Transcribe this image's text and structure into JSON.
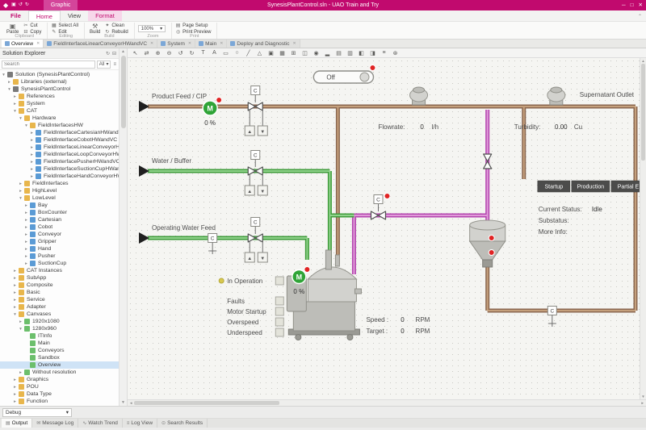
{
  "colors": {
    "accent": "#c10a6e",
    "pipe_brown": "#8a6750",
    "pipe_brown_light": "#c5a07c",
    "pipe_green": "#3f9c3b",
    "pipe_green_light": "#90d28b",
    "pipe_magenta": "#b344ae",
    "pipe_magenta_light": "#e09ad9",
    "motor_green": "#2fa437",
    "alarm_red": "#e02424",
    "button_dark": "#4c4c4b",
    "canvas_bg": "#f5f5f2"
  },
  "titlebar": {
    "context_tab": "Graphic",
    "title": "SynesisPlantControl.sln - UAO Train and Try",
    "quick_access": [
      {
        "name": "save",
        "glyph": "▣"
      },
      {
        "name": "undo",
        "glyph": "↺"
      },
      {
        "name": "redo",
        "glyph": "↻"
      }
    ],
    "window_buttons": [
      {
        "name": "minimize",
        "glyph": "─"
      },
      {
        "name": "maximize",
        "glyph": "□"
      },
      {
        "name": "close",
        "glyph": "✕"
      }
    ]
  },
  "ribbon": {
    "tabs": [
      {
        "label": "File",
        "file": true
      },
      {
        "label": "Home",
        "active": true
      },
      {
        "label": "View"
      },
      {
        "label": "Format",
        "contextual": true
      }
    ],
    "groups": [
      {
        "label": "Clipboard",
        "items": [
          {
            "label": "Paste",
            "glyph": "▣",
            "big": true
          },
          {
            "label": "Cut",
            "glyph": "✂"
          },
          {
            "label": "Copy",
            "glyph": "⊟"
          }
        ]
      },
      {
        "label": "Editing",
        "items": [
          {
            "label": "Select All",
            "glyph": "▦"
          },
          {
            "label": "Edit",
            "glyph": "✎"
          }
        ]
      },
      {
        "label": "Build",
        "items": [
          {
            "label": "Build",
            "glyph": "⚒",
            "big": true
          },
          {
            "label": "Clean",
            "glyph": "✦"
          },
          {
            "label": "Rebuild",
            "glyph": "↻"
          }
        ]
      },
      {
        "label": "Zoom",
        "value": "100%"
      },
      {
        "label": "Print",
        "items": [
          {
            "label": "Page Setup",
            "glyph": "▤"
          },
          {
            "label": "Print Preview",
            "glyph": "◎"
          }
        ]
      }
    ]
  },
  "doc_tabs": [
    {
      "label": "Overview",
      "active": true
    },
    {
      "label": "FieldInterfaceLinearConveyorHWandVC"
    },
    {
      "label": "System"
    },
    {
      "label": "Main"
    },
    {
      "label": "Deploy and Diagnostic"
    }
  ],
  "solution_explorer": {
    "title": "Solution Explorer",
    "search_placeholder": "Search",
    "filter_value": "All",
    "tree": [
      {
        "label": "Solution (SynesisPlantControl)",
        "level": 0,
        "toggle": "open",
        "kind": "sol"
      },
      {
        "label": "Libraries (external)",
        "level": 1,
        "toggle": "closed",
        "kind": "fld"
      },
      {
        "label": "SynesisPlantControl",
        "level": 1,
        "toggle": "open",
        "kind": "sol"
      },
      {
        "label": "References",
        "level": 2,
        "toggle": "closed",
        "kind": "fld"
      },
      {
        "label": "System",
        "level": 2,
        "toggle": "closed",
        "kind": "fld"
      },
      {
        "label": "CAT",
        "level": 2,
        "toggle": "open",
        "kind": "fld"
      },
      {
        "label": "Hardware",
        "level": 3,
        "toggle": "open",
        "kind": "fld"
      },
      {
        "label": "FieldInterfacesHW",
        "level": 4,
        "toggle": "open",
        "kind": "fld"
      },
      {
        "label": "FieldInterfaceCartesianHWandVC",
        "level": 5,
        "toggle": "closed",
        "kind": "pou"
      },
      {
        "label": "FieldInterfaceCobotHWandVC",
        "level": 5,
        "toggle": "closed",
        "kind": "pou"
      },
      {
        "label": "FieldInterfaceLinearConveyorHWandVC",
        "level": 5,
        "toggle": "closed",
        "kind": "pou"
      },
      {
        "label": "FieldInterfaceLoopConveyorHWandVC",
        "level": 5,
        "toggle": "closed",
        "kind": "pou"
      },
      {
        "label": "FieldInterfacePusherHWandVC",
        "level": 5,
        "toggle": "closed",
        "kind": "pou"
      },
      {
        "label": "FieldInterfaceSuctionCupHWandVC",
        "level": 5,
        "toggle": "closed",
        "kind": "pou"
      },
      {
        "label": "FieldInterfaceHandConveyorHWandVC",
        "level": 5,
        "toggle": "closed",
        "kind": "pou"
      },
      {
        "label": "FieldInterfaces",
        "level": 3,
        "toggle": "closed",
        "kind": "fld"
      },
      {
        "label": "HighLevel",
        "level": 3,
        "toggle": "closed",
        "kind": "fld"
      },
      {
        "label": "LowLevel",
        "level": 3,
        "toggle": "open",
        "kind": "fld"
      },
      {
        "label": "Bay",
        "level": 4,
        "toggle": "closed",
        "kind": "pou"
      },
      {
        "label": "BoxCounter",
        "level": 4,
        "toggle": "closed",
        "kind": "pou"
      },
      {
        "label": "Cartesian",
        "level": 4,
        "toggle": "closed",
        "kind": "pou"
      },
      {
        "label": "Cobot",
        "level": 4,
        "toggle": "closed",
        "kind": "pou"
      },
      {
        "label": "Conveyor",
        "level": 4,
        "toggle": "closed",
        "kind": "pou"
      },
      {
        "label": "Gripper",
        "level": 4,
        "toggle": "closed",
        "kind": "pou"
      },
      {
        "label": "Hand",
        "level": 4,
        "toggle": "closed",
        "kind": "pou"
      },
      {
        "label": "Pusher",
        "level": 4,
        "toggle": "closed",
        "kind": "pou"
      },
      {
        "label": "SuctionCup",
        "level": 4,
        "toggle": "closed",
        "kind": "pou"
      },
      {
        "label": "CAT Instances",
        "level": 2,
        "toggle": "closed",
        "kind": "fld"
      },
      {
        "label": "SubApp",
        "level": 2,
        "toggle": "closed",
        "kind": "fld"
      },
      {
        "label": "Composite",
        "level": 2,
        "toggle": "closed",
        "kind": "fld"
      },
      {
        "label": "Basic",
        "level": 2,
        "toggle": "closed",
        "kind": "fld"
      },
      {
        "label": "Service",
        "level": 2,
        "toggle": "closed",
        "kind": "fld"
      },
      {
        "label": "Adapter",
        "level": 2,
        "toggle": "closed",
        "kind": "fld"
      },
      {
        "label": "Canvases",
        "level": 2,
        "toggle": "open",
        "kind": "fld"
      },
      {
        "label": "1920x1080",
        "level": 3,
        "toggle": "closed",
        "kind": "gfx"
      },
      {
        "label": "1280x960",
        "level": 3,
        "toggle": "open",
        "kind": "gfx"
      },
      {
        "label": "ITInfo",
        "level": 4,
        "toggle": "none",
        "kind": "gfx"
      },
      {
        "label": "Main",
        "level": 4,
        "toggle": "none",
        "kind": "gfx"
      },
      {
        "label": "Conveyors",
        "level": 4,
        "toggle": "none",
        "kind": "gfx"
      },
      {
        "label": "Sandbox",
        "level": 4,
        "toggle": "none",
        "kind": "gfx"
      },
      {
        "label": "Overview",
        "level": 4,
        "toggle": "none",
        "kind": "gfx",
        "selected": true
      },
      {
        "label": "Without resolution",
        "level": 3,
        "toggle": "closed",
        "kind": "gfx"
      },
      {
        "label": "Graphics",
        "level": 2,
        "toggle": "closed",
        "kind": "fld"
      },
      {
        "label": "POU",
        "level": 2,
        "toggle": "closed",
        "kind": "fld"
      },
      {
        "label": "Data Type",
        "level": 2,
        "toggle": "closed",
        "kind": "fld"
      },
      {
        "label": "Function",
        "level": 2,
        "toggle": "closed",
        "kind": "fld"
      }
    ]
  },
  "canvas_toolbar": {
    "icons": [
      {
        "name": "select",
        "glyph": "↖"
      },
      {
        "name": "pan",
        "glyph": "⇄"
      },
      {
        "name": "zoom-in",
        "glyph": "⊕"
      },
      {
        "name": "zoom-out",
        "glyph": "⊖"
      },
      {
        "name": "undo",
        "glyph": "↺"
      },
      {
        "name": "redo",
        "glyph": "↻"
      },
      {
        "name": "text",
        "glyph": "T"
      },
      {
        "name": "label",
        "glyph": "A"
      },
      {
        "name": "rectangle",
        "glyph": "▭"
      },
      {
        "name": "ellipse",
        "glyph": "○"
      },
      {
        "name": "line",
        "glyph": "╱"
      },
      {
        "name": "polygon",
        "glyph": "△"
      },
      {
        "name": "image",
        "glyph": "▣"
      },
      {
        "name": "grid",
        "glyph": "▦"
      },
      {
        "name": "table",
        "glyph": "⊞"
      },
      {
        "name": "button-widget",
        "glyph": "◫"
      },
      {
        "name": "gauge",
        "glyph": "◉"
      },
      {
        "name": "chart",
        "glyph": "▂"
      },
      {
        "name": "group",
        "glyph": "▤"
      },
      {
        "name": "ungroup",
        "glyph": "▥"
      },
      {
        "name": "bring-to-front",
        "glyph": "◧"
      },
      {
        "name": "send-to-back",
        "glyph": "◨"
      },
      {
        "name": "align",
        "glyph": "≡"
      },
      {
        "name": "settings",
        "glyph": "⊛"
      }
    ]
  },
  "diagram": {
    "power_toggle": {
      "label": "Off"
    },
    "valve_label": "C",
    "interlock_up": "▲",
    "interlock_down": "▼",
    "motor_letter": "M",
    "motor1_value": "0 %",
    "motor2_value": "0 %",
    "labels": {
      "product_feed": "Product Feed / CIP",
      "water_buffer": "Water / Buffer",
      "operating_water": "Operating Water Feed",
      "supernatant": "Supernatant Outlet"
    },
    "flowrate": {
      "label": "Flowrate:",
      "value": "0",
      "unit": "l/h"
    },
    "turbidity": {
      "label": "Turbidity:",
      "value": "0.00",
      "unit": "Cu"
    },
    "mode_buttons": [
      "Startup",
      "Production",
      "Partial E"
    ],
    "status": {
      "current_label": "Current Status:",
      "current_value": "Idle",
      "substatus_label": "Substatus:",
      "more_info_label": "More Info:"
    },
    "indicators": [
      "In Operation",
      "Faults",
      "Motor Startup",
      "Overspeed",
      "Underspeed"
    ],
    "speed": {
      "label": "Speed :",
      "value": "0",
      "unit": "RPM"
    },
    "target": {
      "label": "Target :",
      "value": "0",
      "unit": "RPM"
    }
  },
  "bottom": {
    "debug_value": "Debug",
    "tabs": [
      {
        "label": "Output",
        "glyph": "▤",
        "active": true
      },
      {
        "label": "Message Log",
        "glyph": "✉"
      },
      {
        "label": "Watch Trend",
        "glyph": "∿"
      },
      {
        "label": "Log View",
        "glyph": "≡"
      },
      {
        "label": "Search Results",
        "glyph": "⊙"
      }
    ]
  }
}
